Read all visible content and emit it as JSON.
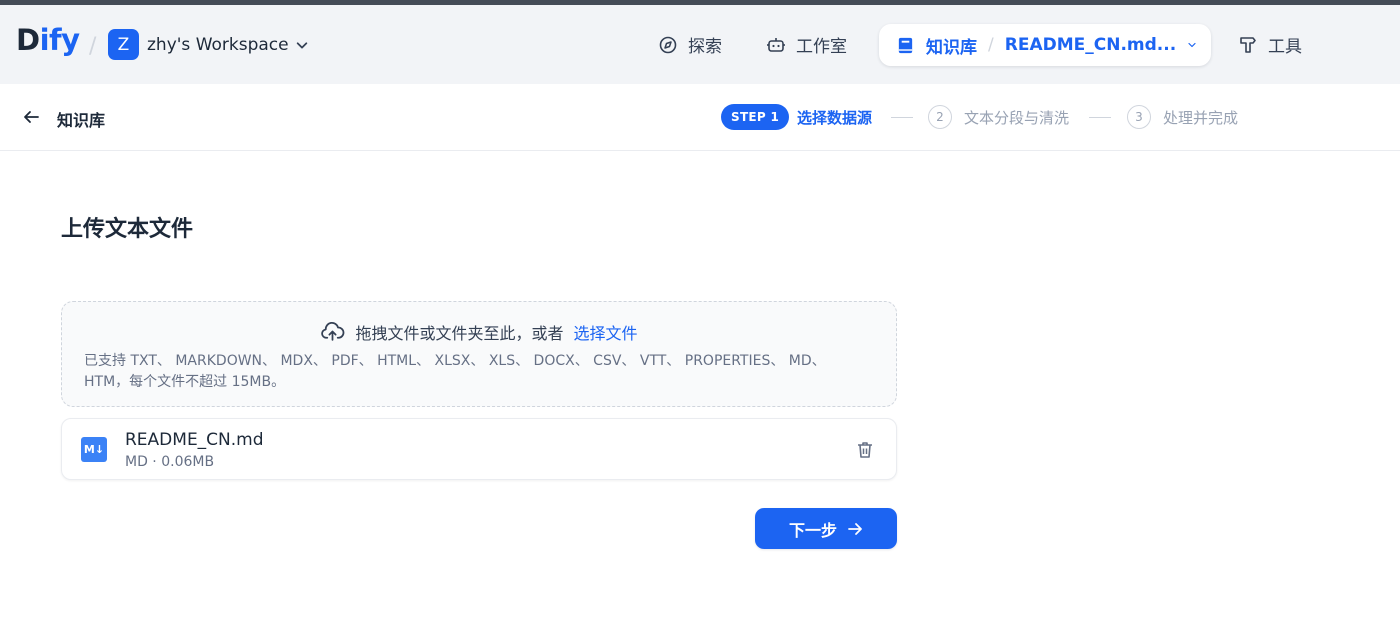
{
  "header": {
    "logo_main": "D",
    "logo_accent": "ify",
    "workspace": {
      "avatar_letter": "Z",
      "name": "zhy's Workspace"
    },
    "nav": {
      "explore": "探索",
      "studio": "工作室",
      "knowledge": "知识库",
      "current_doc": "README_CN.md...",
      "tools": "工具"
    }
  },
  "subheader": {
    "back_label": "知识库",
    "steps": {
      "step1_badge": "STEP 1",
      "step1_label": "选择数据源",
      "step2_num": "2",
      "step2_label": "文本分段与清洗",
      "step3_num": "3",
      "step3_label": "处理并完成"
    }
  },
  "main": {
    "title": "上传文本文件",
    "dropzone": {
      "prompt": "拖拽文件或文件夹至此，或者",
      "link": "选择文件",
      "hint": "已支持 TXT、 MARKDOWN、 MDX、 PDF、 HTML、 XLSX、 XLS、 DOCX、 CSV、 VTT、 PROPERTIES、 MD、 HTM，每个文件不超过 15MB。"
    },
    "file": {
      "icon_text": "M↓",
      "name": "README_CN.md",
      "meta": "MD · 0.06MB"
    },
    "next_button": "下一步"
  },
  "colors": {
    "accent": "#1c64f2",
    "header_bg": "#f2f4f7"
  },
  "icons": {
    "explore": "compass-icon",
    "studio": "robot-icon",
    "knowledge": "book-icon",
    "tools": "hammer-icon",
    "upload": "cloud-upload-icon",
    "delete": "trash-icon"
  }
}
